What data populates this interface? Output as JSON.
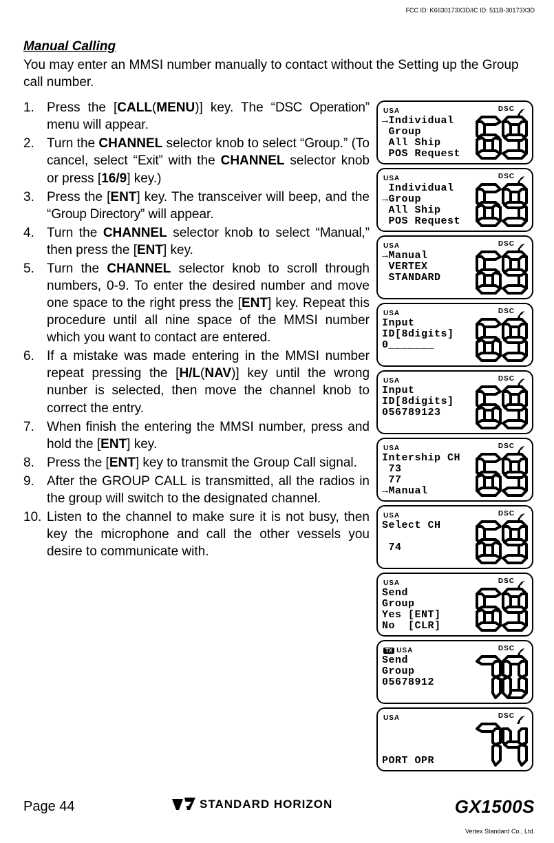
{
  "fcc_id": "FCC ID: K6630173X3D/IC ID: 511B-30173X3D",
  "section_title": "Manual Calling",
  "intro": "You may enter an MMSI number manually to contact without the Setting up the Group call number.",
  "steps": [
    {
      "pre": "Press the [",
      "k1": "CALL",
      "paren_open": "(",
      "k2": "MENU",
      "paren_close": ")",
      "post1": "] key. The “",
      "menu1": "DSC Operation",
      "post2": "” menu will appear."
    },
    {
      "pre": "Turn the ",
      "k1": "CHANNEL",
      "post1": " selector knob to select “",
      "menu1": "Group",
      "post2": ".” (To cancel, select “",
      "menu2": "Exit",
      "post3": "” with the ",
      "k2": "CHANNEL",
      "post4": " selector knob or press [",
      "k3": "16/9",
      "post5": "] key.)"
    },
    {
      "pre": "Press the [",
      "k1": "ENT",
      "post1": "] key. The transceiver will beep, and the “",
      "menu1": "Group Directory",
      "post2": "” will appear."
    },
    {
      "pre": "Turn the ",
      "k1": "CHANNEL",
      "post1": " selector knob to select “",
      "menu1": "Manual",
      "post2": ",” then press the [",
      "k2": "ENT",
      "post3": "] key."
    },
    {
      "pre": "Turn the ",
      "k1": "CHANNEL",
      "post1": " selector knob to scroll through numbers, 0-9. To enter the desired number and move one space to the right press the [",
      "k2": "ENT",
      "post2": "] key. Repeat this procedure until all nine space of the MMSI number which you want to contact are entered."
    },
    {
      "pre": "If a mistake was made entering in the MMSI number repeat pressing the [",
      "k1": "H/L",
      "paren_open": "(",
      "k2": "NAV",
      "paren_close": ")",
      "post1": "] key until the wrong nunber is selected, then move the channel knob to correct the entry."
    },
    {
      "pre": "When finish the entering the MMSI number, press and hold the [",
      "k1": "ENT",
      "post1": "] key."
    },
    {
      "pre": "Press the [",
      "k1": "ENT",
      "post1": "] key to transmit the Group Call signal."
    },
    {
      "pre": "After the GROUP CALL is transmitted, all the radios in the group will switch to the designated channel."
    },
    {
      "pre": "Listen to the channel to make sure it is not busy, then key the microphone and call the other vessels you desire to communicate with."
    }
  ],
  "screens": [
    {
      "tx": false,
      "big": "69",
      "lines": [
        "→Individual",
        " Group",
        " All Ship",
        " POS Request"
      ]
    },
    {
      "tx": false,
      "big": "69",
      "lines": [
        " Individual",
        "→Group",
        " All Ship",
        " POS Request"
      ]
    },
    {
      "tx": false,
      "big": "69",
      "lines": [
        "→Manual",
        " VERTEX",
        " STANDARD",
        ""
      ]
    },
    {
      "tx": false,
      "big": "69",
      "lines": [
        "Input",
        "ID[8digits]",
        "0_______",
        ""
      ]
    },
    {
      "tx": false,
      "big": "69",
      "lines": [
        "Input",
        "ID[8digits]",
        "056789123",
        ""
      ]
    },
    {
      "tx": false,
      "big": "69",
      "lines": [
        "Intership CH",
        " 73",
        " 77",
        "→Manual"
      ]
    },
    {
      "tx": false,
      "big": "69",
      "lines": [
        "Select CH",
        "",
        " 74",
        ""
      ]
    },
    {
      "tx": false,
      "big": "69",
      "lines": [
        "Send",
        "Group",
        "Yes [ENT]",
        "No  [CLR]"
      ]
    },
    {
      "tx": true,
      "big": "70",
      "lines": [
        "Send",
        "Group",
        "05678912",
        ""
      ]
    },
    {
      "tx": false,
      "big": "74",
      "lines": [
        "",
        "",
        "",
        "PORT OPR"
      ]
    }
  ],
  "usa_label": "USA",
  "dsc_label": "DSC",
  "tx_label": "TX",
  "footer": {
    "page": "Page 44",
    "brand": "STANDARD HORIZON",
    "model": "GX1500S"
  },
  "vendor": "Vertex Standard Co., Ltd."
}
